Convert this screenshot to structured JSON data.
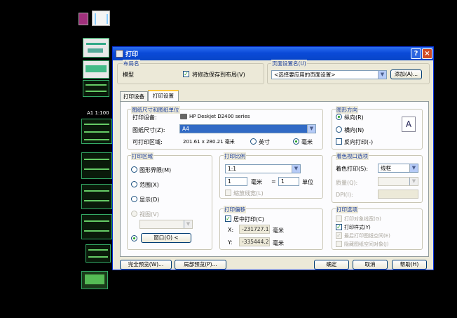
{
  "background": {
    "color": "#000000",
    "sheet_label": "A1 1:100"
  },
  "dialog": {
    "title": "打印",
    "help_icon": "?",
    "close_icon": "×",
    "layout_group": {
      "label": "布局名",
      "value": "模型",
      "save_changes": "将修改保存到布局(V)",
      "save_checked": true
    },
    "page_setup_group": {
      "label": "页面设置名(U)",
      "selected": "<选择要应用的页面设置>",
      "add_button": "添加(A)..."
    },
    "tabs": [
      {
        "label": "打印设备",
        "active": false
      },
      {
        "label": "打印设置",
        "active": true
      }
    ],
    "paper_group": {
      "label": "图纸尺寸和图纸单位",
      "device_label": "打印设备:",
      "device_value": "HP Deskjet D2400 series",
      "paper_size_label": "图纸尺寸(Z):",
      "paper_size_value": "A4",
      "printable_label": "可打印区域:",
      "printable_value": "201.61 x 280.21 毫米",
      "unit_inches": "英寸",
      "unit_mm": "毫米",
      "selected_unit": "mm"
    },
    "orientation_group": {
      "label": "图形方向",
      "portrait": "纵向(R)",
      "landscape": "横向(N)",
      "reverse": "反向打印(-)",
      "selected": "portrait",
      "reverse_checked": false,
      "preview_letter": "A"
    },
    "area_group": {
      "label": "打印区域",
      "limits": "图形界限(M)",
      "extents": "范围(X)",
      "display": "显示(D)",
      "view": "视图(V)",
      "window_button": "窗口(O) <",
      "selected": "window"
    },
    "scale_group": {
      "label": "打印比例",
      "scale": "1:1",
      "value1": "1",
      "unit1": "毫米",
      "equals": "=",
      "value2": "1",
      "unit2": "单位",
      "lineweights": "缩放线宽(L)"
    },
    "shade_group": {
      "label": "着色视口选项",
      "shade_label": "着色打印(S):",
      "shade_value": "线框",
      "quality_label": "质量(Q):",
      "dpi_label": "DPI(I):"
    },
    "offset_group": {
      "label": "打印偏移",
      "center": "居中打印(C)",
      "center_checked": true,
      "x_label": "X:",
      "x_value": "-231727.13",
      "x_unit": "毫米",
      "y_label": "Y:",
      "y_value": "-335444.25",
      "y_unit": "毫米"
    },
    "options_group": {
      "label": "打印选项",
      "opt_lineweights": "打印对象线宽(G)",
      "opt_styles": "打印样式(Y)",
      "opt_paperspace_last": "最后打印图纸空间(E)",
      "opt_hide": "隐藏图纸空间对象(J)",
      "styles_checked": true,
      "paperspace_checked": true
    },
    "footer": {
      "full_preview": "完全预览(W)...",
      "partial_preview": "局部预览(P)...",
      "ok": "确定",
      "cancel": "取消",
      "help": "帮助(H)"
    }
  }
}
